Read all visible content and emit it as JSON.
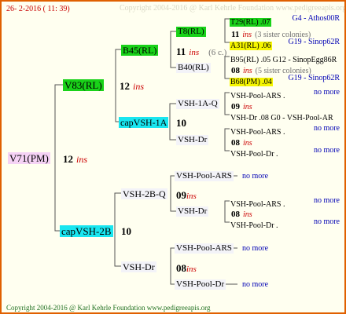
{
  "header": {
    "text": "26-  2-2016 ( 11: 39)"
  },
  "watermark": {
    "text": "Copyright 2004-2016 @ Karl Kehrle Foundation    www.pedigreeapis.org"
  },
  "footer": {
    "text": "Copyright 2004-2016 @ Karl Kehrle Foundation    www.pedigreeapis.org"
  },
  "root": {
    "name": "V71(PM)",
    "count": "12",
    "tag": "ins"
  },
  "gen1": {
    "top": {
      "name": "V83(RL)",
      "count": "12",
      "tag": "ins"
    },
    "bottom": {
      "name": "capVSH-2B",
      "count": "10"
    }
  },
  "gen2": {
    "a": {
      "name": "B45(RL)",
      "count": "11",
      "tag": "ins",
      "note": "(6 c.)"
    },
    "b": {
      "name": "capVSH-1A",
      "count": "10"
    },
    "c": {
      "name": "VSH-2B-Q",
      "count": "09",
      "tag": "ins"
    },
    "d": {
      "name": "VSH-Dr",
      "count": "08",
      "tag": "ins"
    }
  },
  "gen3": {
    "t8": {
      "name": "T8(RL)",
      "count": "11",
      "tag": "ins",
      "note": "(3 sister colonies)"
    },
    "b40": {
      "name": "B40(RL)",
      "count": "08",
      "tag": "ins",
      "note": "(5 sister colonies)"
    },
    "vsh1aq": {
      "name": "VSH-1A-Q",
      "count": "09",
      "tag": "ins"
    },
    "vshdr1": {
      "name": "VSH-Dr",
      "count": "08",
      "tag": "ins"
    },
    "poolars1": {
      "name": "VSH-Pool-ARS",
      "nomore": "no more"
    },
    "vshdr2": {
      "name": "VSH-Dr",
      "count": "08",
      "tag": "ins"
    },
    "poolars2": {
      "name": "VSH-Pool-ARS",
      "nomore": "no more"
    },
    "pooldr": {
      "name": "VSH-Pool-Dr",
      "nomore": "no more"
    }
  },
  "gen4": [
    {
      "name": "T29(RL) .07",
      "right": "G4 - Athos00R",
      "style": "green"
    },
    {
      "name": "A31(RL) .06",
      "right": "G19 - Sinop62R",
      "style": "yellow"
    },
    {
      "name": "B95(RL) .05 G12 - SinopEgg86R",
      "right": "",
      "style": "none"
    },
    {
      "name": "B68(PM) .04",
      "right": "G19 - Sinop62R",
      "style": "yellow"
    },
    {
      "name": "VSH-Pool-ARS .",
      "right": "no more",
      "style": "none"
    },
    {
      "name": "VSH-Dr .08   G0 - VSH-Pool-AR",
      "right": "",
      "style": "none"
    },
    {
      "name": "VSH-Pool-ARS .",
      "right": "no more",
      "style": "none"
    },
    {
      "name": "VSH-Pool-Dr .",
      "right": "no more",
      "style": "none"
    },
    {
      "name": "VSH-Pool-ARS .",
      "right": "no more",
      "style": "none"
    },
    {
      "name": "VSH-Pool-Dr .",
      "right": "no more",
      "style": "none"
    }
  ]
}
